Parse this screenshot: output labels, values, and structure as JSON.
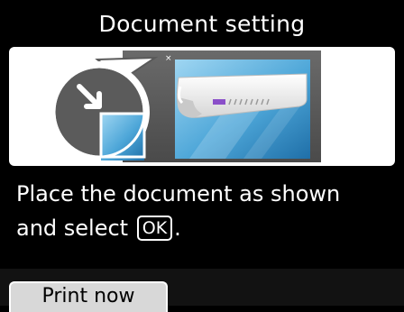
{
  "screen": {
    "title": "Document setting",
    "instruction": {
      "line1": "Place the document as shown",
      "line2_prefix": "and select",
      "ok_key_label": "OK",
      "line2_suffix": "."
    },
    "print_now_label": "Print now"
  },
  "illustration": {
    "icons": [
      "document-corner-icon",
      "scanner-platen-icon",
      "document-sheet-icon"
    ]
  },
  "colors": {
    "background": "#000000",
    "panel": "#ffffff",
    "text": "#ffffff",
    "scanner_body": "#5a5a5a",
    "glass": "#4da6d8",
    "document_mark": "#8a4fc9",
    "button": "#d8d8d8"
  }
}
